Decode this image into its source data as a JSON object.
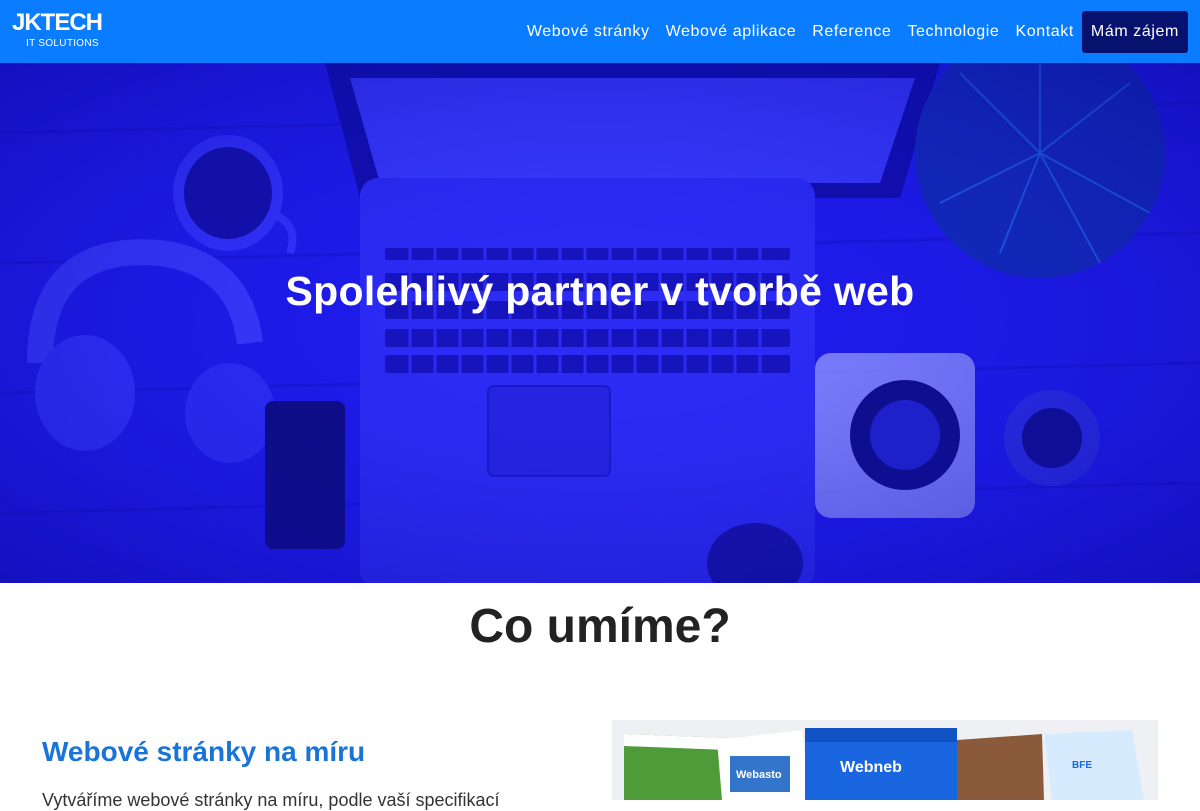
{
  "brand": {
    "logo_main": "JKTECH",
    "logo_sub": "IT SOLUTIONS"
  },
  "nav": {
    "items": [
      {
        "label": "Webové stránky"
      },
      {
        "label": "Webové aplikace"
      },
      {
        "label": "Reference"
      },
      {
        "label": "Technologie"
      },
      {
        "label": "Kontakt"
      }
    ],
    "cta_label": "Mám zájem"
  },
  "hero": {
    "title": "Spolehlivý partner v tvorbě web"
  },
  "services": {
    "section_title": "Co umíme?",
    "items": [
      {
        "title": "Webové stránky na míru",
        "text": "Vytváříme webové stránky na míru, podle vaší specifikací"
      }
    ]
  },
  "showcase": {
    "screens": [
      "Webasto",
      "Webneb",
      "BFE"
    ]
  },
  "colors": {
    "navbar": "#0a7cff",
    "cta": "#06126e",
    "hero_tint": "#1a16e6",
    "service_title": "#1a73d8"
  }
}
